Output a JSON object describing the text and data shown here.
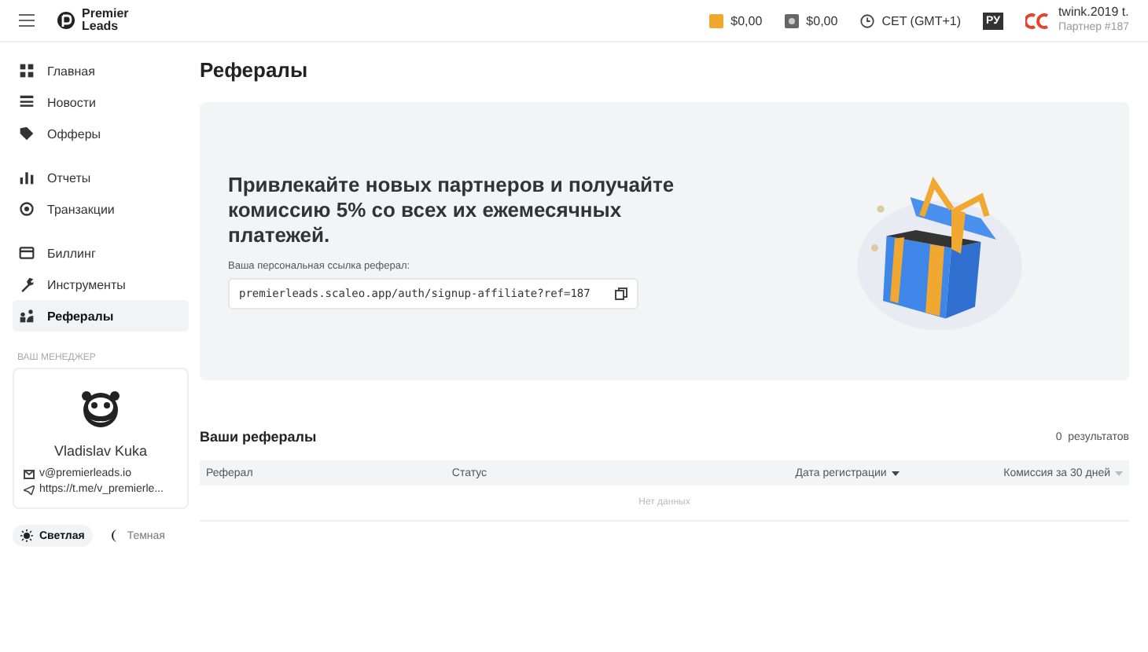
{
  "header": {
    "logo": [
      "Premier",
      "Leads"
    ],
    "balances": [
      {
        "kind": "wallet",
        "amount": "$0,00"
      },
      {
        "kind": "safe",
        "amount": "$0,00"
      }
    ],
    "timezone": "CET (GMT+1)",
    "language": {
      "label": "РУ",
      "selected": true
    },
    "user": {
      "name": "twink.2019 t.",
      "role": "Партнер #187"
    }
  },
  "sidebar": {
    "groups": [
      [
        {
          "label": "Главная",
          "selected": false
        },
        {
          "label": "Новости",
          "selected": false
        },
        {
          "label": "Офферы",
          "selected": false
        }
      ],
      [
        {
          "label": "Отчеты",
          "selected": false
        },
        {
          "label": "Транзакции",
          "selected": false
        }
      ],
      [
        {
          "label": "Биллинг",
          "selected": false
        },
        {
          "label": "Инструменты",
          "selected": false
        },
        {
          "label": "Рефералы",
          "selected": true
        }
      ]
    ],
    "manager": {
      "heading": "ВАШ МЕНЕДЖЕР",
      "name": "Vladislav Kuka",
      "email": "v@premierleads.io",
      "telegram": "https://t.me/v_premierle..."
    },
    "themes": [
      {
        "kind": "light",
        "label": "Светлая",
        "selected": true
      },
      {
        "kind": "dark",
        "label": "Темная",
        "selected": false
      }
    ]
  },
  "page": {
    "title": "Рефералы",
    "banner": {
      "headline": "Привлекайте новых партнеров и получайте комиссию 5% со всех их ежемесячных платежей.",
      "link_label": "Ваша персональная ссылка реферал:",
      "link": "premierleads.scaleo.app/auth/signup-affiliate?ref=187"
    },
    "referrals": {
      "title": "Ваши рефералы",
      "count": "0  результатов",
      "columns": [
        {
          "label": "Реферал",
          "kind": "plain"
        },
        {
          "label": "Статус",
          "kind": "plain"
        },
        {
          "label": "Дата регистрации",
          "kind": "sortable",
          "sorted": true
        },
        {
          "label": "Комиссия за 30 дней",
          "kind": "sortable",
          "sorted": false
        }
      ],
      "empty": "Нет данных"
    }
  }
}
